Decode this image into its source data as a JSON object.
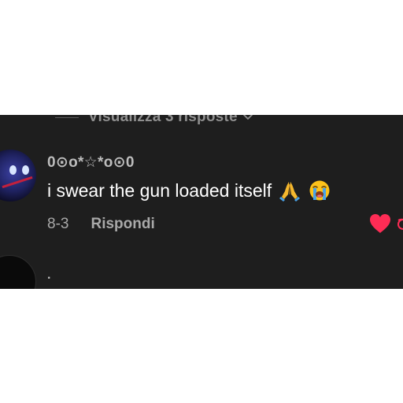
{
  "replies": {
    "label": "Visualizza 3 risposte",
    "chevron_icon": "chevron-down-icon"
  },
  "comment": {
    "avatar_icon": "spiderman-avatar",
    "username": "0⊙o*☆*o⊙0",
    "text": "i swear the gun loaded itself",
    "emojis": [
      "folded-hands-emoji",
      "loudly-crying-face-emoji"
    ],
    "date": "8-3",
    "reply_label": "Rispondi",
    "like_icon": "heart-icon",
    "like_color": "#fe2c55"
  },
  "next_comment": {
    "text": "."
  },
  "colors": {
    "panel_background": "#1e1e1e",
    "page_background": "#ffffff"
  }
}
